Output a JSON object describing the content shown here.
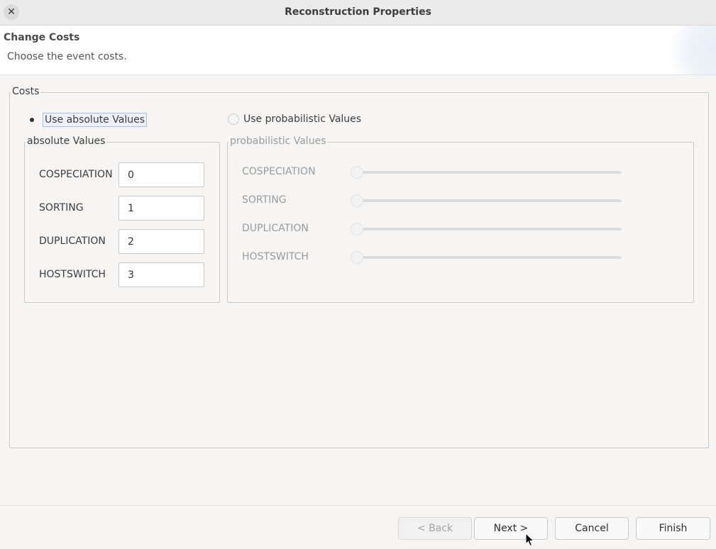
{
  "window": {
    "title": "Reconstruction Properties",
    "close_glyph": "✕"
  },
  "banner": {
    "title": "Change Costs",
    "description": "Choose the event costs."
  },
  "costs": {
    "group_label": "Costs",
    "radio_absolute": {
      "label": "Use absolute Values",
      "checked": true
    },
    "radio_probabilistic": {
      "label": "Use probabilistic Values",
      "checked": false
    },
    "absolute": {
      "group_label": "absolute Values",
      "rows": [
        {
          "label": "COSPECIATION",
          "value": "0"
        },
        {
          "label": "SORTING",
          "value": "1"
        },
        {
          "label": "DUPLICATION",
          "value": "2"
        },
        {
          "label": "HOSTSWITCH",
          "value": "3"
        }
      ]
    },
    "probabilistic": {
      "group_label": "probabilistic Values",
      "enabled": false,
      "rows": [
        {
          "label": "COSPECIATION",
          "level": 0
        },
        {
          "label": "SORTING",
          "level": 0
        },
        {
          "label": "DUPLICATION",
          "level": 0
        },
        {
          "label": "HOSTSWITCH",
          "level": 0
        }
      ]
    }
  },
  "buttons": {
    "back": "< Back",
    "next": "Next >",
    "cancel": "Cancel",
    "finish": "Finish"
  },
  "icons": {
    "close": "close-icon",
    "cursor": "mouse-pointer-icon"
  }
}
